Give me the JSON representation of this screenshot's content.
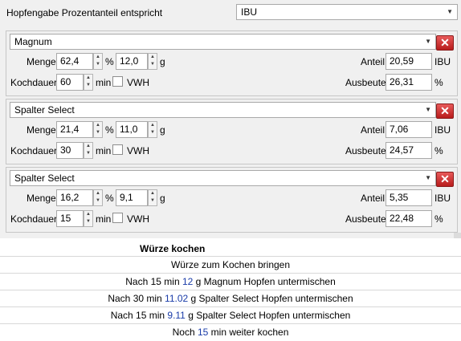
{
  "header": {
    "label": "Hopfengabe Prozentanteil entspricht",
    "select_value": "IBU"
  },
  "hops": [
    {
      "name": "Magnum",
      "menge_label": "Menge",
      "menge_pct": "62,4",
      "pct_unit": "%",
      "menge_g": "12,0",
      "g_unit": "g",
      "kochdauer_label": "Kochdauer",
      "kochdauer": "60",
      "min_unit": "min",
      "vwh_label": "VWH",
      "anteil_label": "Anteil",
      "anteil": "20,59",
      "anteil_unit": "IBU",
      "ausbeute_label": "Ausbeute",
      "ausbeute": "26,31",
      "ausbeute_unit": "%"
    },
    {
      "name": "Spalter Select",
      "menge_label": "Menge",
      "menge_pct": "21,4",
      "pct_unit": "%",
      "menge_g": "11,0",
      "g_unit": "g",
      "kochdauer_label": "Kochdauer",
      "kochdauer": "30",
      "min_unit": "min",
      "vwh_label": "VWH",
      "anteil_label": "Anteil",
      "anteil": "7,06",
      "anteil_unit": "IBU",
      "ausbeute_label": "Ausbeute",
      "ausbeute": "24,57",
      "ausbeute_unit": "%"
    },
    {
      "name": "Spalter Select",
      "menge_label": "Menge",
      "menge_pct": "16,2",
      "pct_unit": "%",
      "menge_g": "9,1",
      "g_unit": "g",
      "kochdauer_label": "Kochdauer",
      "kochdauer": "15",
      "min_unit": "min",
      "vwh_label": "VWH",
      "anteil_label": "Anteil",
      "anteil": "5,35",
      "anteil_unit": "IBU",
      "ausbeute_label": "Ausbeute",
      "ausbeute": "22,48",
      "ausbeute_unit": "%"
    }
  ],
  "icons": {
    "delete": "close-icon",
    "dropdown": "chevron-down-icon",
    "spin": "up-down-arrows-icon"
  },
  "colors": {
    "delete_button": "#c62828",
    "value_highlight": "#1a3ca8"
  },
  "steps": {
    "title": "Würze kochen",
    "lines": [
      {
        "pre": "Würze zum Kochen bringen",
        "val": "",
        "post": ""
      },
      {
        "pre": "Nach 15 min ",
        "val": "12",
        "post": " g Magnum Hopfen untermischen"
      },
      {
        "pre": "Nach 30 min ",
        "val": "11.02",
        "post": " g Spalter Select Hopfen untermischen"
      },
      {
        "pre": "Nach 15 min ",
        "val": "9.11",
        "post": " g Spalter Select Hopfen untermischen"
      },
      {
        "pre": "Noch ",
        "val": "15",
        "post": " min weiter kochen"
      }
    ]
  }
}
